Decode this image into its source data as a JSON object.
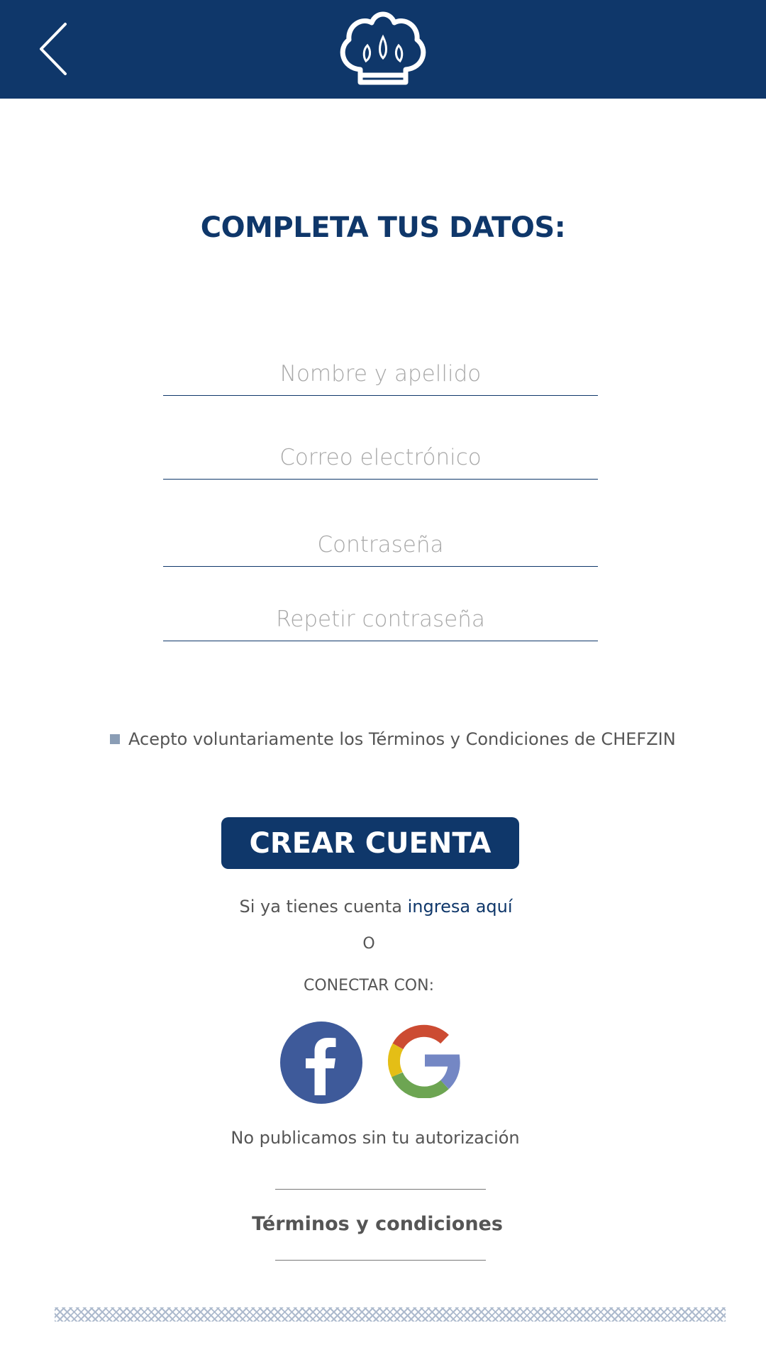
{
  "header": {
    "back_icon": "chevron-left-icon",
    "logo_icon": "chef-hat-icon",
    "background": "#0f376a"
  },
  "form": {
    "title": "COMPLETA TUS DATOS:",
    "name_placeholder": "Nombre y apellido",
    "email_placeholder": "Correo electrónico",
    "password_placeholder": "Contraseña",
    "repeat_password_placeholder": "Repetir contraseña",
    "terms_checkbox_label": "Acepto voluntariamente los Términos y Condiciones de CHEFZIN",
    "create_button": "CREAR CUENTA"
  },
  "login": {
    "prefix": "Si ya tienes cuenta",
    "link": "ingresa aquí"
  },
  "social": {
    "or": "O",
    "connect": "CONECTAR CON:",
    "facebook_icon": "facebook-icon",
    "google_icon": "google-icon",
    "privacy_note": "No publicamos sin tu autorización"
  },
  "footer": {
    "terms_link": "Términos y condiciones"
  },
  "colors": {
    "primary": "#0f376a",
    "facebook": "#3e5a9a"
  }
}
